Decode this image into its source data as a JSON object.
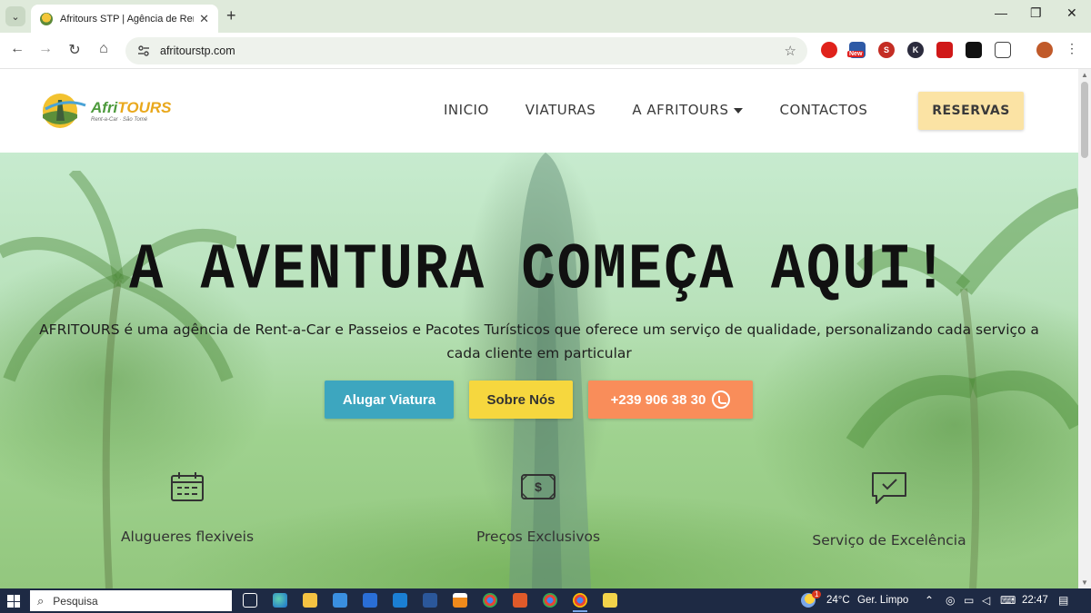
{
  "browser": {
    "tab_title": "Afritours STP | Agência de Rent",
    "tab_close": "✕",
    "new_tab": "+",
    "url": "afritourstp.com",
    "controls": {
      "minimize": "—",
      "restore": "❐",
      "close": "✕"
    },
    "nav": {
      "back": "←",
      "forward": "→",
      "reload": "↻",
      "home": "⌂"
    },
    "bookmark_star": "☆",
    "extension_badge": "New"
  },
  "site": {
    "logo": {
      "afri": "Afri",
      "tours": "TOURS",
      "tagline": "Rent-a-Car · São Tomé"
    },
    "nav": [
      {
        "label": "INICIO"
      },
      {
        "label": "VIATURAS"
      },
      {
        "label": "A AFRITOURS"
      },
      {
        "label": "CONTACTOS"
      }
    ],
    "reserve_label": "RESERVAS"
  },
  "hero": {
    "title": "A AVENTURA COMEÇA AQUI!",
    "description": "AFRITOURS é uma agência de Rent-a-Car e Passeios e Pacotes Turísticos que oferece um serviço de qualidade, personalizando cada serviço a cada cliente em particular",
    "buttons": {
      "rent": "Alugar Viatura",
      "about": "Sobre Nós",
      "phone": "+239 906 38 30"
    },
    "features": [
      {
        "label": "Alugueres flexiveis",
        "icon": "calendar-icon"
      },
      {
        "label": "Preços Exclusivos",
        "icon": "money-icon"
      },
      {
        "label": "Serviço de Excelência",
        "icon": "chat-check-icon"
      }
    ]
  },
  "taskbar": {
    "search_placeholder": "Pesquisa",
    "weather_temp": "24°C",
    "weather_desc": "Ger. Limpo",
    "weather_badge": "1",
    "time": "22:47"
  },
  "colors": {
    "rent_button": "#3da6bf",
    "about_button": "#f6d73e",
    "phone_button": "#f98d5a",
    "reserve_button": "#fbe3a4",
    "logo_green": "#4d9a3c",
    "logo_orange": "#e9a81c"
  }
}
